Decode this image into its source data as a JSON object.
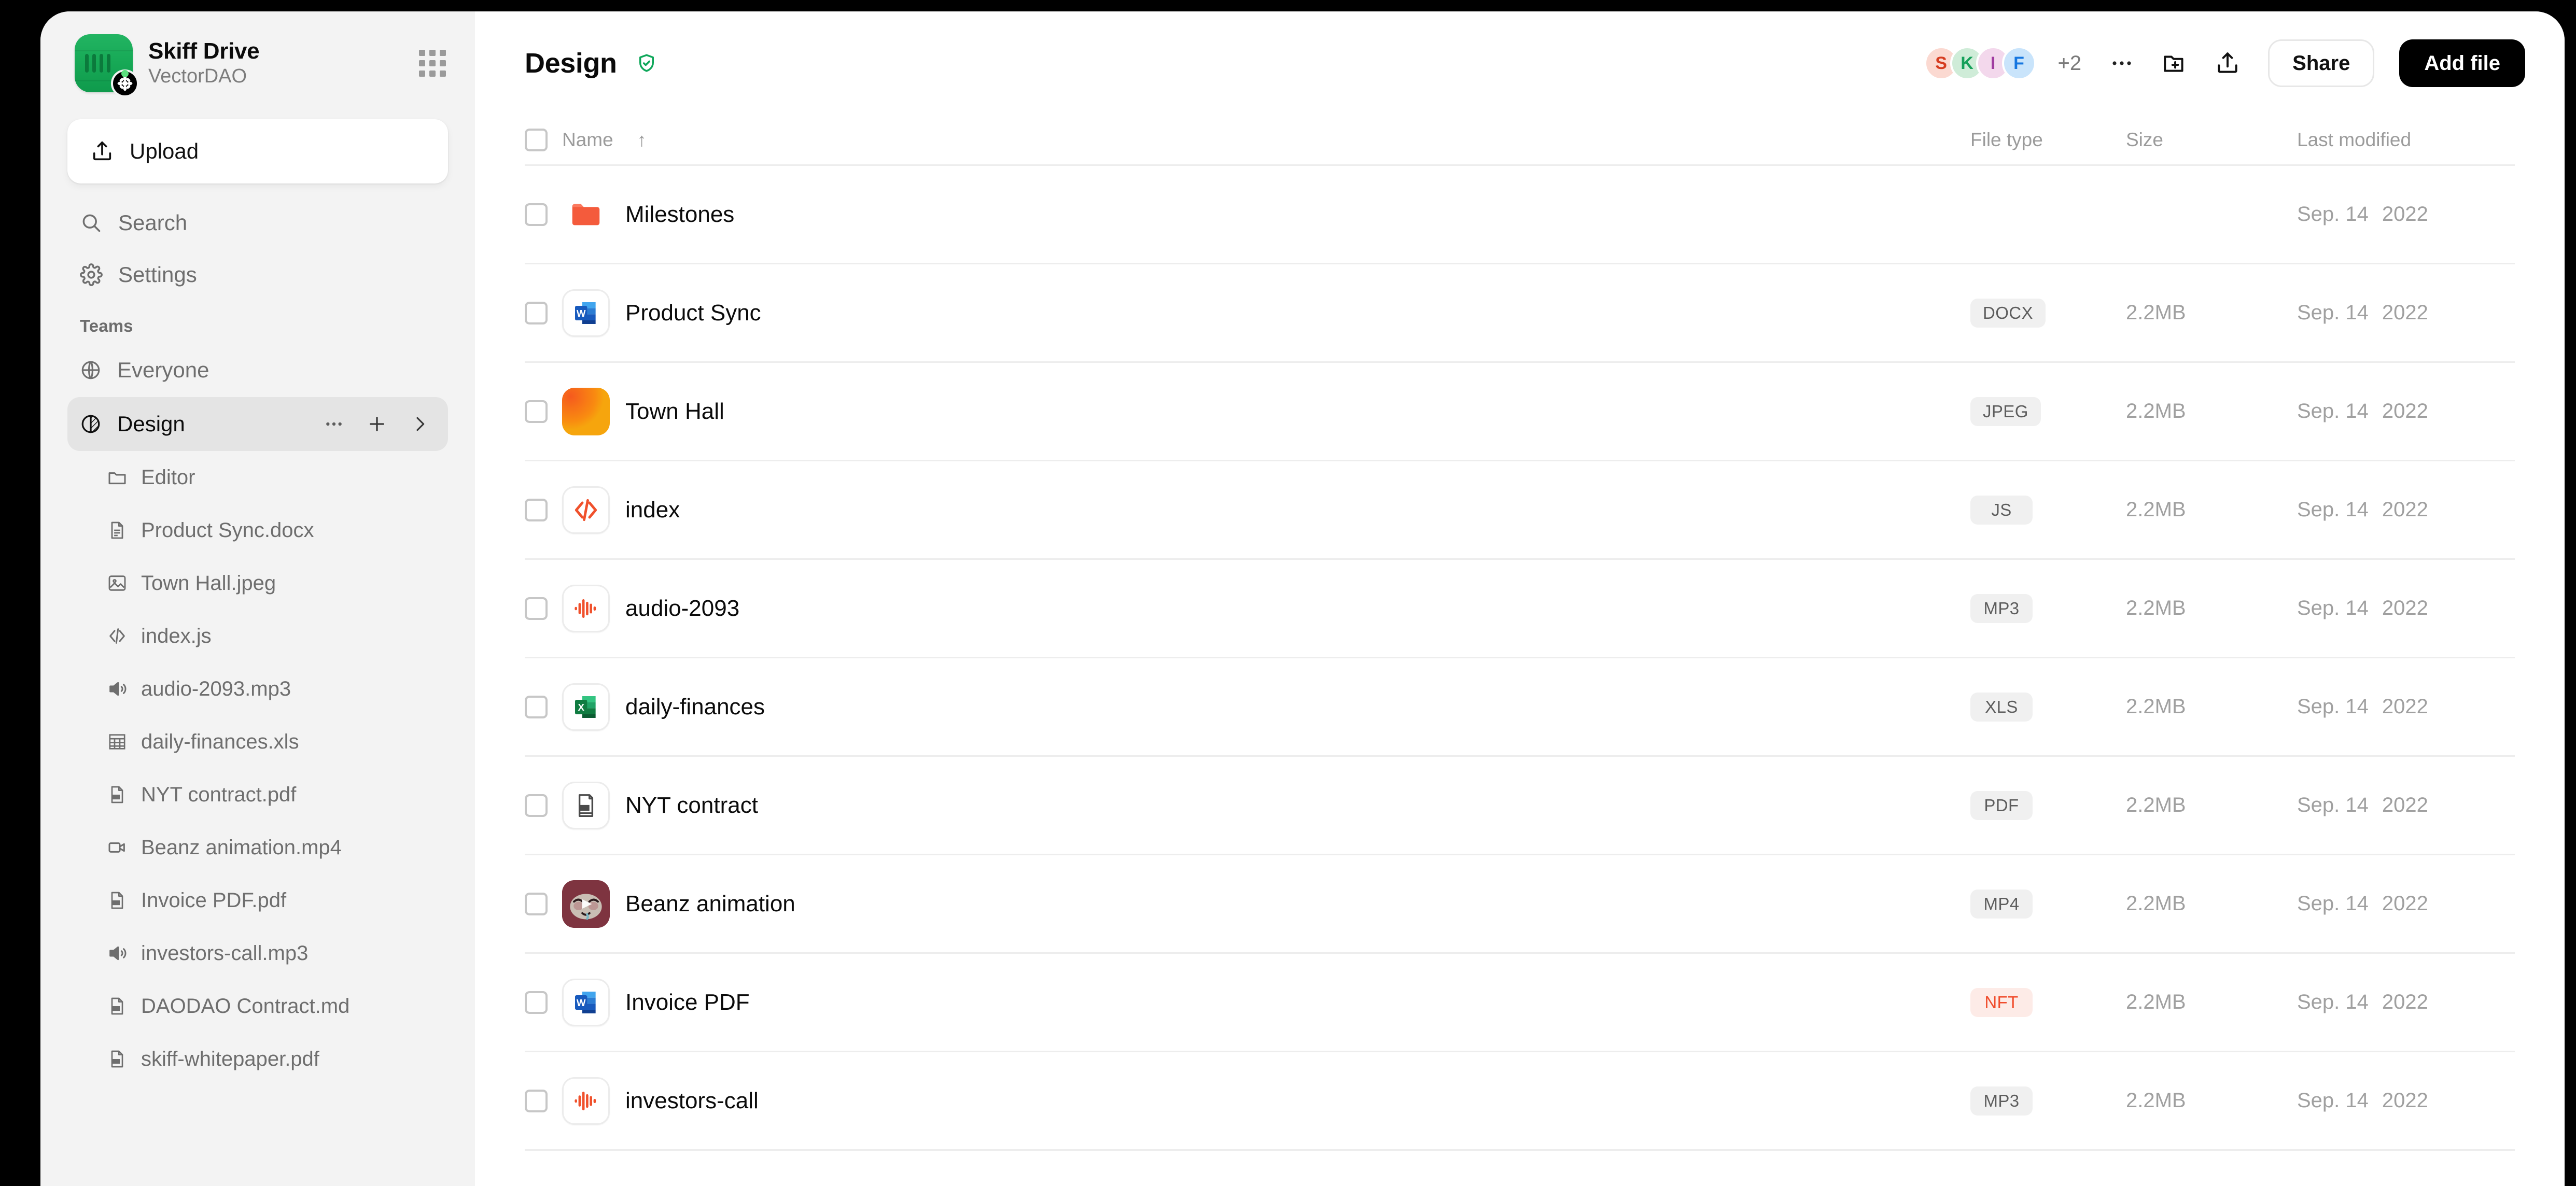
{
  "sidebar": {
    "app_title": "Skiff Drive",
    "workspace": "VectorDAO",
    "apps_icon": "apps-grid-icon",
    "upload_label": "Upload",
    "nav": [
      {
        "label": "Search",
        "icon": "search-icon"
      },
      {
        "label": "Settings",
        "icon": "gear-icon"
      }
    ],
    "section_label": "Teams",
    "teams": [
      {
        "label": "Everyone",
        "icon": "globe-icon",
        "active": false
      },
      {
        "label": "Design",
        "icon": "half-circle-icon",
        "active": true
      }
    ],
    "team_actions": [
      "more-icon",
      "plus-icon",
      "chevron-right-icon"
    ],
    "files": [
      {
        "label": "Editor",
        "icon": "folder-icon"
      },
      {
        "label": "Product Sync.docx",
        "icon": "document-icon"
      },
      {
        "label": "Town Hall.jpeg",
        "icon": "image-icon"
      },
      {
        "label": "index.js",
        "icon": "code-icon"
      },
      {
        "label": "audio-2093.mp3",
        "icon": "speaker-icon"
      },
      {
        "label": "daily-finances.xls",
        "icon": "table-icon"
      },
      {
        "label": "NYT contract.pdf",
        "icon": "pdf-icon"
      },
      {
        "label": "Beanz animation.mp4",
        "icon": "video-icon"
      },
      {
        "label": "Invoice PDF.pdf",
        "icon": "pdf-icon"
      },
      {
        "label": "investors-call.mp3",
        "icon": "speaker-icon"
      },
      {
        "label": "DAODAO Contract.md",
        "icon": "md-icon"
      },
      {
        "label": "skiff-whitepaper.pdf",
        "icon": "pdf-icon"
      }
    ]
  },
  "header": {
    "title": "Design",
    "verified_icon": "shield-check-icon",
    "verified_color": "#0ea75a",
    "avatars": [
      {
        "initial": "S",
        "bg": "#fbd9d1",
        "fg": "#d63c20"
      },
      {
        "initial": "K",
        "bg": "#cfecd8",
        "fg": "#16a05a"
      },
      {
        "initial": "I",
        "bg": "#f3d8ec",
        "fg": "#a03ca0"
      },
      {
        "initial": "F",
        "bg": "#c9e4fb",
        "fg": "#1476e0"
      }
    ],
    "avatar_overflow": "+2",
    "more_icon": "more-horizontal-icon",
    "new_folder_icon": "folder-plus-icon",
    "upload_icon": "upload-icon",
    "share_label": "Share",
    "add_file_label": "Add file"
  },
  "table": {
    "columns": {
      "name": "Name",
      "sort_indicator": "↑",
      "file_type": "File type",
      "size": "Size",
      "last_modified": "Last modified"
    },
    "rows": [
      {
        "name": "Milestones",
        "icon": "folder-red-icon",
        "type": "",
        "size": "",
        "date": "Sep. 14",
        "year": "2022",
        "type_style": "none"
      },
      {
        "name": "Product Sync",
        "icon": "word-icon",
        "type": "DOCX",
        "size": "2.2MB",
        "date": "Sep. 14",
        "year": "2022",
        "type_style": "default"
      },
      {
        "name": "Town Hall",
        "icon": "image-thumb-icon",
        "type": "JPEG",
        "size": "2.2MB",
        "date": "Sep. 14",
        "year": "2022",
        "type_style": "default"
      },
      {
        "name": "index",
        "icon": "code-icon",
        "type": "JS",
        "size": "2.2MB",
        "date": "Sep. 14",
        "year": "2022",
        "type_style": "default"
      },
      {
        "name": "audio-2093",
        "icon": "waveform-icon",
        "type": "MP3",
        "size": "2.2MB",
        "date": "Sep. 14",
        "year": "2022",
        "type_style": "default"
      },
      {
        "name": "daily-finances",
        "icon": "excel-icon",
        "type": "XLS",
        "size": "2.2MB",
        "date": "Sep. 14",
        "year": "2022",
        "type_style": "default"
      },
      {
        "name": "NYT contract",
        "icon": "pdf-doc-icon",
        "type": "PDF",
        "size": "2.2MB",
        "date": "Sep. 14",
        "year": "2022",
        "type_style": "default"
      },
      {
        "name": "Beanz animation",
        "icon": "nft-thumb-icon",
        "type": "MP4",
        "size": "2.2MB",
        "date": "Sep. 14",
        "year": "2022",
        "type_style": "default"
      },
      {
        "name": "Invoice PDF",
        "icon": "word-icon",
        "type": "NFT",
        "size": "2.2MB",
        "date": "Sep. 14",
        "year": "2022",
        "type_style": "nft"
      },
      {
        "name": "investors-call",
        "icon": "waveform-icon",
        "type": "MP3",
        "size": "2.2MB",
        "date": "Sep. 14",
        "year": "2022",
        "type_style": "default"
      }
    ]
  },
  "colors": {
    "accent_green": "#17a956",
    "accent_red": "#f0512c",
    "nft_badge_bg": "#fdebe7",
    "nft_badge_fg": "#f04c2c",
    "sidebar_bg": "#f3f3f3",
    "active_row_bg": "#e4e4e4"
  }
}
